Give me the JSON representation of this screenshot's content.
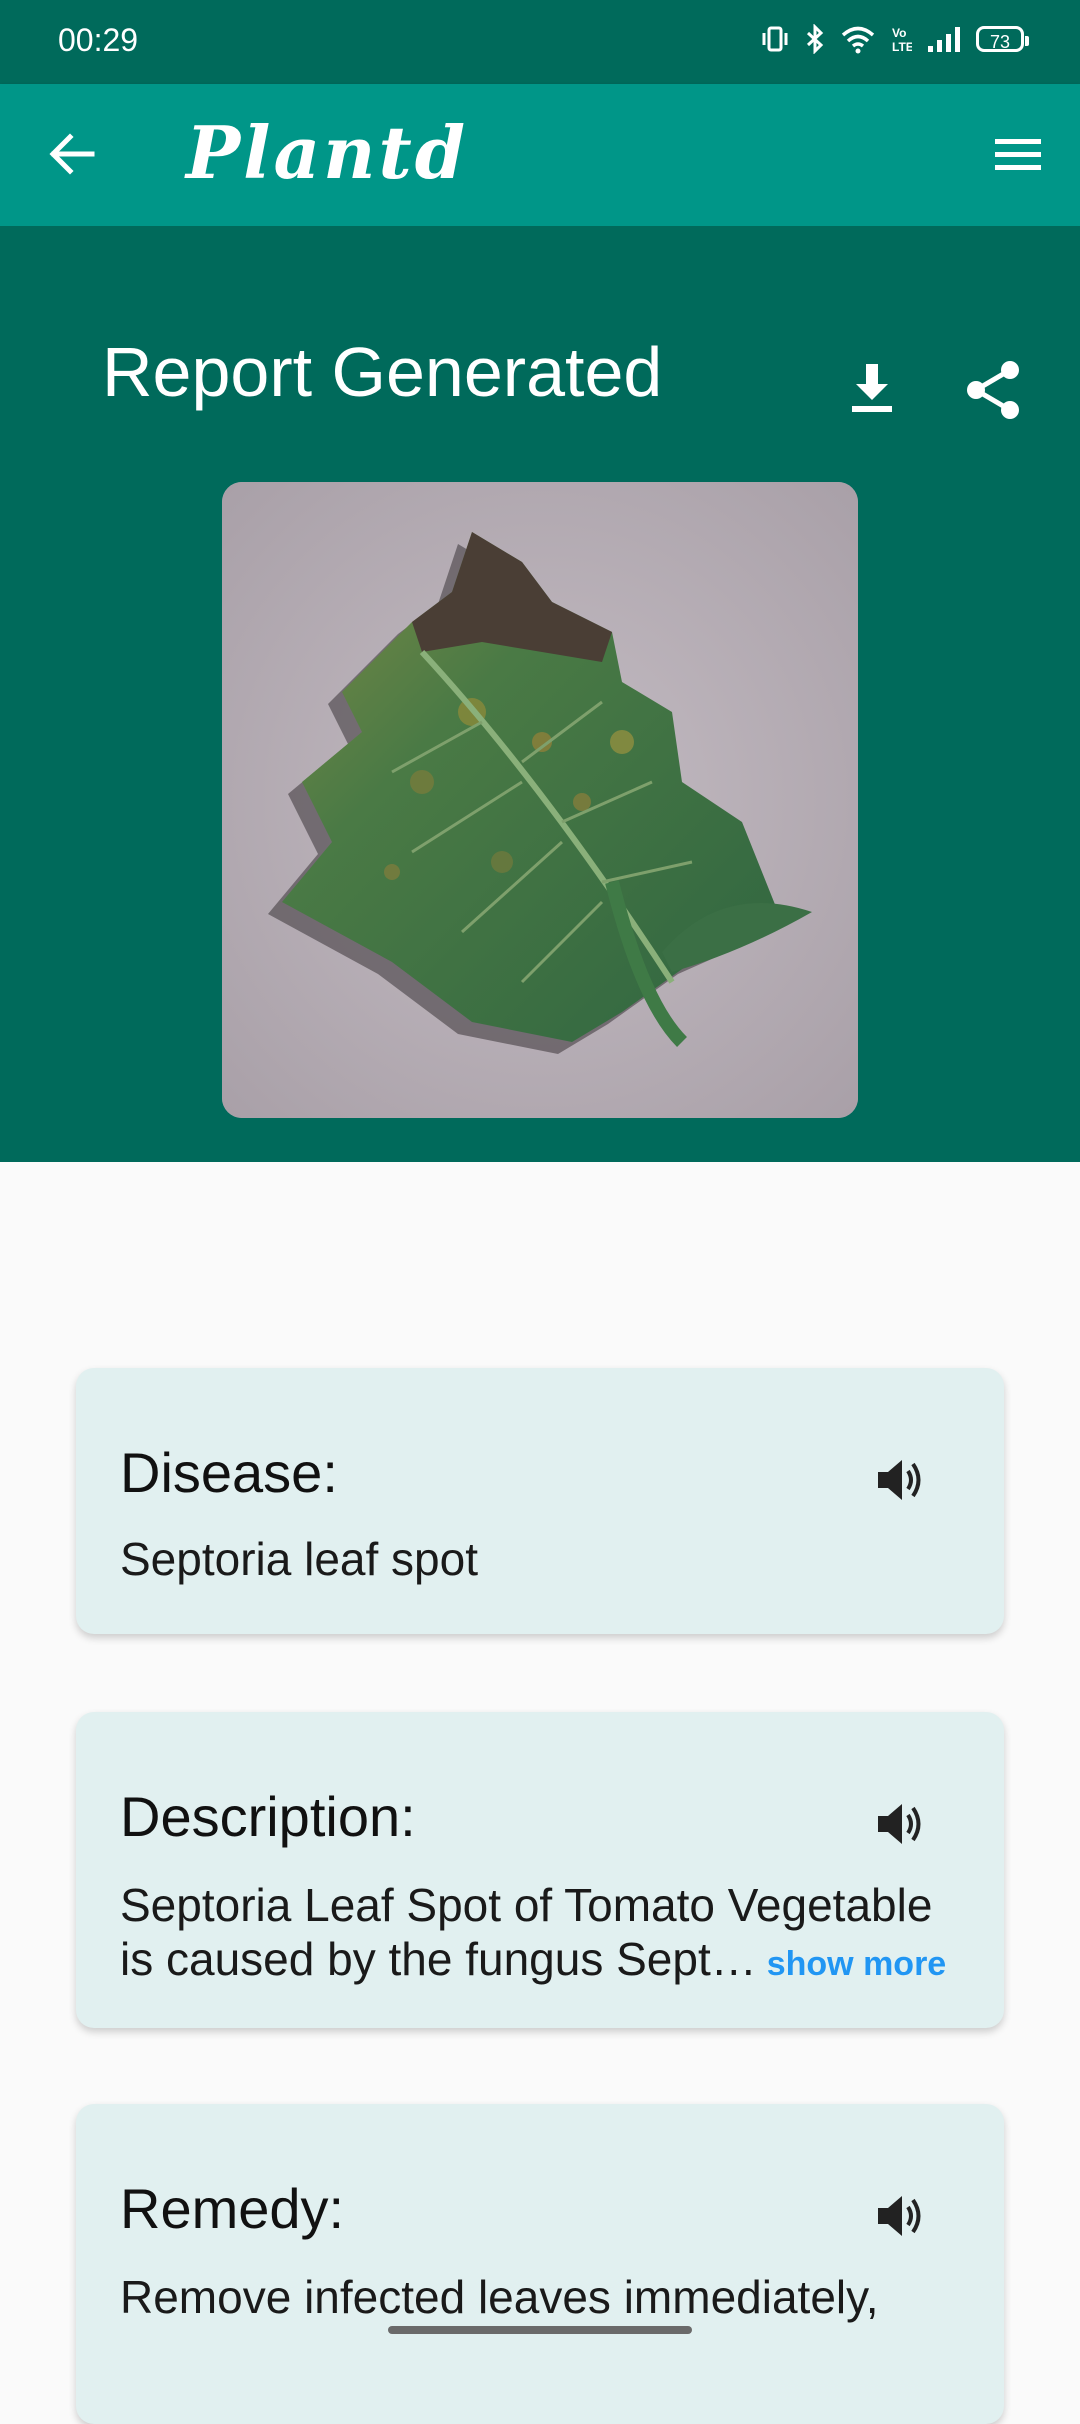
{
  "status_bar": {
    "time": "00:29",
    "battery": "73"
  },
  "app_bar": {
    "title": "Plantd"
  },
  "hero": {
    "title": "Report Generated"
  },
  "cards": {
    "disease": {
      "heading": "Disease:",
      "text": "Septoria leaf spot"
    },
    "description": {
      "heading": "Description:",
      "line1": "Septoria Leaf Spot of Tomato Vegetable",
      "line2": "is caused by the fungus Sept…",
      "show_more": "show more"
    },
    "remedy": {
      "heading": "Remedy:",
      "line1": "Remove infected leaves immediately,"
    }
  },
  "colors": {
    "status_bar": "#006a5b",
    "app_bar": "#009688",
    "hero": "#006a5b",
    "card_bg": "#e1f0f0",
    "link": "#2196f3"
  },
  "icons": [
    "vibrate-icon",
    "bluetooth-icon",
    "wifi-icon",
    "volte-icon",
    "signal-icon",
    "battery-icon",
    "back-arrow-icon",
    "menu-icon",
    "download-icon",
    "share-icon",
    "speaker-icon"
  ]
}
